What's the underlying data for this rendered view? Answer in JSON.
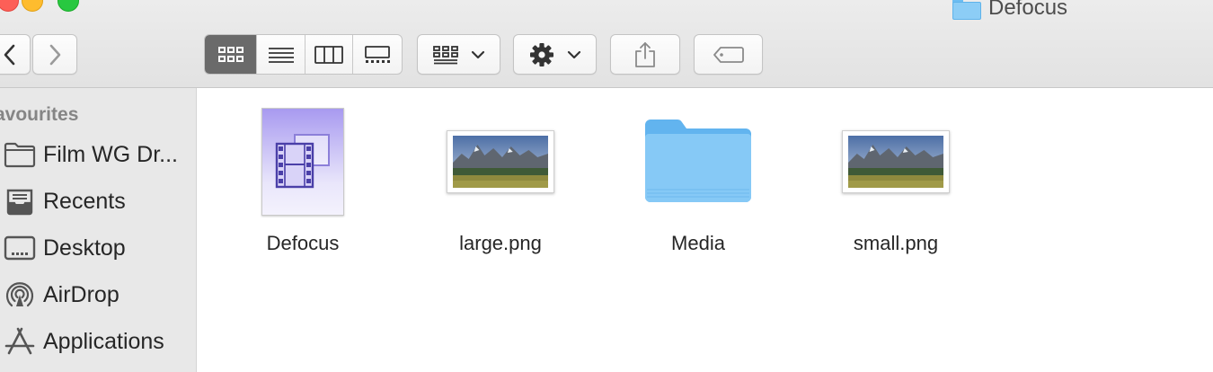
{
  "window": {
    "title": "Defocus"
  },
  "toolbar": {
    "back_icon": "chevron-left-icon",
    "forward_icon": "chevron-right-icon",
    "view_modes": [
      {
        "icon": "icon-view-icon",
        "active": true
      },
      {
        "icon": "list-view-icon",
        "active": false
      },
      {
        "icon": "column-view-icon",
        "active": false
      },
      {
        "icon": "gallery-view-icon",
        "active": false
      }
    ],
    "group_icon": "group-by-icon",
    "action_icon": "gear-icon",
    "share_icon": "share-icon",
    "tag_icon": "tag-icon"
  },
  "sidebar": {
    "header": "avourites",
    "items": [
      {
        "label": "Film WG Dr...",
        "icon": "folder-icon"
      },
      {
        "label": "Recents",
        "icon": "recents-icon"
      },
      {
        "label": "Desktop",
        "icon": "desktop-icon"
      },
      {
        "label": "AirDrop",
        "icon": "airdrop-icon"
      },
      {
        "label": "Applications",
        "icon": "applications-icon"
      }
    ]
  },
  "files": [
    {
      "name": "Defocus",
      "kind": "movie-project"
    },
    {
      "name": "large.png",
      "kind": "image"
    },
    {
      "name": "Media",
      "kind": "folder"
    },
    {
      "name": "small.png",
      "kind": "image"
    }
  ],
  "colors": {
    "folder": "#7cc4f5",
    "active_segment": "#6a6a6a",
    "sidebar_bg": "#e8e8e8",
    "doc_purple": "#a89af0"
  }
}
